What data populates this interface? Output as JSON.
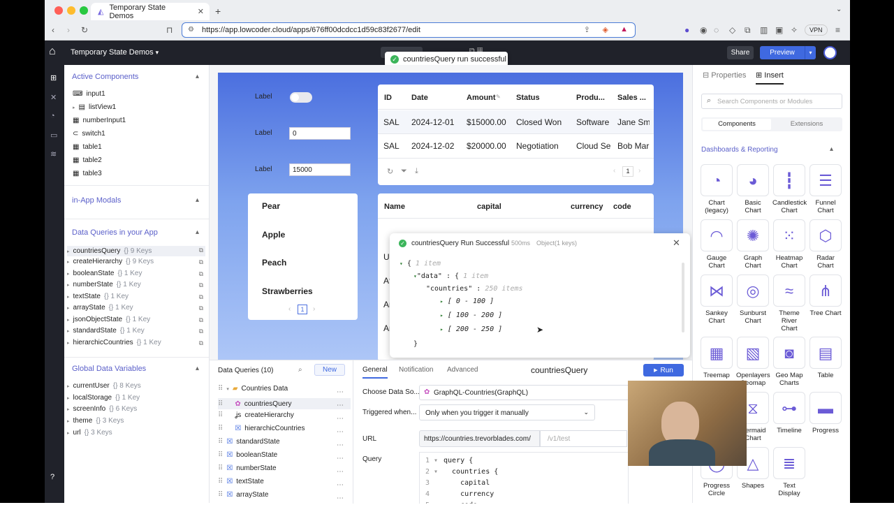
{
  "browser": {
    "tab_title": "Temporary State Demos",
    "url": "https://app.lowcoder.cloud/apps/676ff00dcdcc1d59c83f2677/edit",
    "vpn_label": "VPN"
  },
  "topbar": {
    "app_name": "Temporary State Demos",
    "share_label": "Share",
    "preview_label": "Preview",
    "toast": "countriesQuery run successful"
  },
  "left": {
    "active_title": "Active Components",
    "components": [
      "input1",
      "listView1",
      "numberInput1",
      "switch1",
      "table1",
      "table2",
      "table3"
    ],
    "modals_title": "in-App Modals",
    "queries_title": "Data Queries in your App",
    "queries": [
      {
        "name": "countriesQuery",
        "meta": "{} 9 Keys"
      },
      {
        "name": "createHierarchy",
        "meta": "{} 9 Keys"
      },
      {
        "name": "booleanState",
        "meta": "{} 1 Key"
      },
      {
        "name": "numberState",
        "meta": "{} 1 Key"
      },
      {
        "name": "textState",
        "meta": "{} 1 Key"
      },
      {
        "name": "arrayState",
        "meta": "{} 1 Key"
      },
      {
        "name": "jsonObjectState",
        "meta": "{} 1 Key"
      },
      {
        "name": "standardState",
        "meta": "{} 1 Key"
      },
      {
        "name": "hierarchicCountries",
        "meta": "{} 1 Key"
      }
    ],
    "globals_title": "Global Data Variables",
    "globals": [
      {
        "name": "currentUser",
        "meta": "{} 8 Keys"
      },
      {
        "name": "localStorage",
        "meta": "{} 1 Key"
      },
      {
        "name": "screenInfo",
        "meta": "{} 6 Keys"
      },
      {
        "name": "theme",
        "meta": "{} 3 Keys"
      },
      {
        "name": "url",
        "meta": "{} 3 Keys"
      }
    ]
  },
  "canvas": {
    "label1": "Label",
    "label2": "Label",
    "label3": "Label",
    "input2_value": "0",
    "input3_value": "15000",
    "list": [
      "Pear",
      "Apple",
      "Peach",
      "Strawberries"
    ],
    "list_page": "1",
    "table1": {
      "headers": [
        "ID",
        "Date",
        "Amount",
        "Status",
        "Produ...",
        "Sales ..."
      ],
      "rows": [
        [
          "SAL",
          "2024-12-01",
          "$15000.00",
          "Closed Won",
          "Software",
          "Jane Sm"
        ],
        [
          "SAL",
          "2024-12-02",
          "$20000.00",
          "Negotiation",
          "Cloud Se",
          "Bob Mar"
        ]
      ],
      "page": "1"
    },
    "table2": {
      "headers": [
        "Name",
        "capital",
        "currency",
        "code"
      ],
      "partial_rows": [
        "An",
        "Ur",
        "Af",
        "Ar",
        "Ar"
      ]
    }
  },
  "popup": {
    "title": "countriesQuery Run Successful",
    "timing": "500ms",
    "meta": "Object(1 keys)",
    "l1": "{",
    "l1_meta": "1 item",
    "l2_key": "\"data\"",
    "l2_sep": ": {",
    "l2_meta": "1 item",
    "l3_key": "\"countries\"",
    "l3_sep": ":",
    "l3_meta": "250 items",
    "ranges": [
      "[ 0 - 100 ]",
      "[ 100 - 200 ]",
      "[ 200 - 250 ]"
    ],
    "close": "}"
  },
  "bottom": {
    "list_title": "Data Queries (10)",
    "new_label": "New",
    "folder": "Countries Data",
    "items": [
      "countriesQuery",
      "createHierarchy",
      "hierarchicCountries",
      "standardState",
      "booleanState",
      "numberState",
      "textState",
      "arrayState"
    ],
    "tabs": [
      "General",
      "Notification",
      "Advanced"
    ],
    "query_name": "countriesQuery",
    "run_label": "Run",
    "datasource_label": "Choose Data So...",
    "datasource_value": "GraphQL-Countries(GraphQL)",
    "trigger_label": "Triggered when...",
    "trigger_value": "Only when you trigger it manually",
    "url_label": "URL",
    "url_base": "https://countries.trevorblades.com/",
    "url_placeholder": "/v1/test",
    "query_label": "Query",
    "code": [
      "query {",
      "  countries {",
      "    capital",
      "    currency",
      "    code"
    ]
  },
  "right": {
    "tab_properties": "Properties",
    "tab_insert": "Insert",
    "search_placeholder": "Search Components or Modules",
    "sub_components": "Components",
    "sub_extensions": "Extensions",
    "section": "Dashboards & Reporting",
    "tiles": [
      "Chart (legacy)",
      "Basic Chart",
      "Candlestick Chart",
      "Funnel Chart",
      "Gauge Chart",
      "Graph Chart",
      "Heatmap Chart",
      "Radar Chart",
      "Sankey Chart",
      "Sunburst Chart",
      "Theme River Chart",
      "Tree Chart",
      "Treemap",
      "Openlayers Geomap",
      "Geo Map Charts",
      "Table",
      "",
      "Mermaid Chart",
      "Timeline",
      "Progress",
      "Progress Circle",
      "Shapes",
      "Text Display",
      ""
    ]
  }
}
